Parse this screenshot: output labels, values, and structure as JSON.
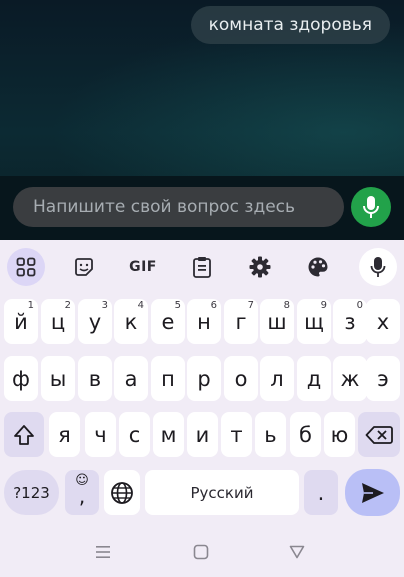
{
  "chat": {
    "message": "комната здоровья",
    "input_placeholder": "Напишите свой вопрос здесь"
  },
  "toolbar": {
    "items": [
      "apps-grid-icon",
      "sticker-icon",
      "GIF",
      "clipboard-icon",
      "gear-icon",
      "palette-icon",
      "mic-icon"
    ],
    "gif_label": "GIF"
  },
  "keyboard": {
    "row1": [
      {
        "k": "й",
        "h": "1"
      },
      {
        "k": "ц",
        "h": "2"
      },
      {
        "k": "у",
        "h": "3"
      },
      {
        "k": "к",
        "h": "4"
      },
      {
        "k": "е",
        "h": "5"
      },
      {
        "k": "н",
        "h": "6"
      },
      {
        "k": "г",
        "h": "7"
      },
      {
        "k": "ш",
        "h": "8"
      },
      {
        "k": "щ",
        "h": "9"
      },
      {
        "k": "з",
        "h": "0"
      },
      {
        "k": "х",
        "h": ""
      }
    ],
    "row2": [
      "ф",
      "ы",
      "в",
      "а",
      "п",
      "р",
      "о",
      "л",
      "д",
      "ж",
      "э"
    ],
    "row3": [
      "я",
      "ч",
      "с",
      "м",
      "и",
      "т",
      "ь",
      "б",
      "ю"
    ],
    "symbols_label": "?123",
    "emoji_comma": ",",
    "space_label": "Русский",
    "period_label": "."
  },
  "colors": {
    "accent": "#b9bff6",
    "mic_green": "#22a24a",
    "keyboard_bg": "#f1ecf6",
    "modifier_key": "#dfdaf0"
  }
}
